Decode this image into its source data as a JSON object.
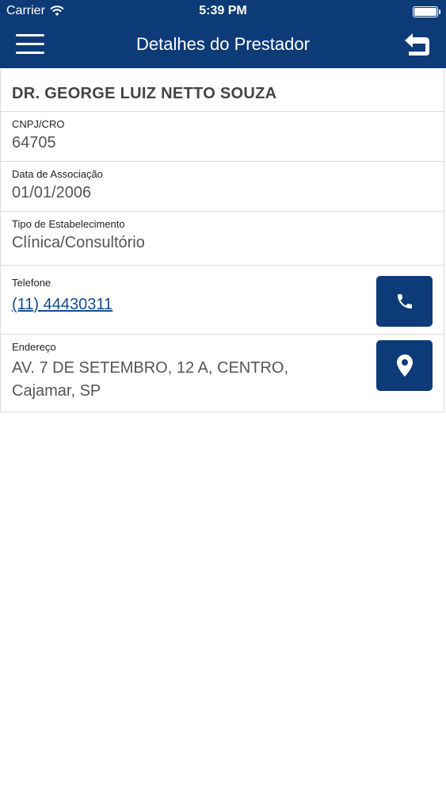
{
  "status_bar": {
    "carrier": "Carrier",
    "time": "5:39 PM"
  },
  "navbar": {
    "title": "Detalhes do Prestador",
    "menu_icon": "hamburger-menu-icon",
    "back_icon": "return-arrow-icon",
    "background_color": "#0d3b77"
  },
  "provider": {
    "name": "DR. GEORGE LUIZ NETTO SOUZA",
    "fields": {
      "cnpj_cro": {
        "label": "CNPJ/CRO",
        "value": "64705"
      },
      "association_date": {
        "label": "Data de Associação",
        "value": "01/01/2006"
      },
      "establishment_type": {
        "label": "Tipo de Estabelecimento",
        "value": "Clínica/Consultório"
      },
      "phone": {
        "label": "Telefone",
        "value": "(11) 44430311",
        "action_icon": "phone-icon"
      },
      "address": {
        "label": "Endereço",
        "line1": "AV. 7 DE SETEMBRO, 12 A, CENTRO,",
        "line2": "Cajamar, SP",
        "action_icon": "map-pin-icon"
      }
    }
  }
}
